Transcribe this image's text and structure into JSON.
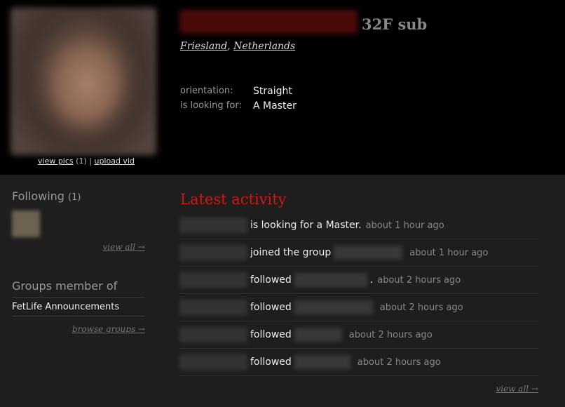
{
  "profile": {
    "age_gender_role": "32F sub",
    "location": {
      "region": "Friesland",
      "separator": ",",
      "country": "Netherlands"
    },
    "pics_label": "view pics",
    "pics_count": "(1)",
    "upload_label": "upload vid",
    "details": [
      {
        "key": "orientation:",
        "value": "Straight"
      },
      {
        "key": "is looking for:",
        "value": "A Master"
      }
    ]
  },
  "sidebar": {
    "following_title": "Following",
    "following_count": "(1)",
    "view_all": "view all →",
    "groups_title": "Groups member of",
    "groups": [
      "FetLife Announcements"
    ],
    "browse_groups": "browse groups →"
  },
  "activity": {
    "title": "Latest activity",
    "items": [
      {
        "action": "is looking for a Master.",
        "time": "about 1 hour ago"
      },
      {
        "action": "joined the group",
        "time": "about 1 hour ago"
      },
      {
        "action": "followed",
        "suffix": ".",
        "time": "about 2 hours ago"
      },
      {
        "action": "followed",
        "time": "about 2 hours ago"
      },
      {
        "action": "followed",
        "time": "about 2 hours ago"
      },
      {
        "action": "followed",
        "time": "about 2 hours ago"
      }
    ],
    "view_all": "view all →"
  },
  "colors": {
    "accent_red": "#c81b1b",
    "header_bg": "#000000",
    "body_bg": "#1e1e1e"
  }
}
